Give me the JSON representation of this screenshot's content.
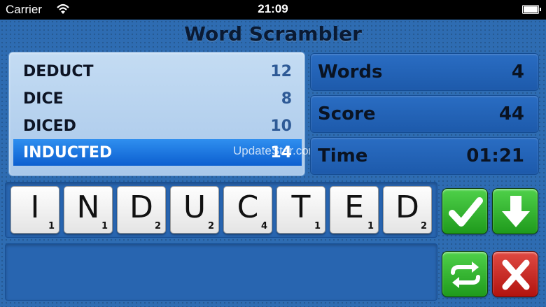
{
  "status_bar": {
    "carrier": "Carrier",
    "time": "21:09"
  },
  "app": {
    "title": "Word Scrambler"
  },
  "words": [
    {
      "word": "DEDUCT",
      "points": "12",
      "selected": false
    },
    {
      "word": "DICE",
      "points": "8",
      "selected": false
    },
    {
      "word": "DICED",
      "points": "10",
      "selected": false
    },
    {
      "word": "INDUCTED",
      "points": "14",
      "selected": true
    }
  ],
  "watermark": "UpdateStar.com",
  "stats": {
    "words_label": "Words",
    "words_value": "4",
    "score_label": "Score",
    "score_value": "44",
    "time_label": "Time",
    "time_value": "01:21"
  },
  "tiles": [
    {
      "letter": "I",
      "points": "1"
    },
    {
      "letter": "N",
      "points": "1"
    },
    {
      "letter": "D",
      "points": "2"
    },
    {
      "letter": "U",
      "points": "2"
    },
    {
      "letter": "C",
      "points": "4"
    },
    {
      "letter": "T",
      "points": "1"
    },
    {
      "letter": "E",
      "points": "1"
    },
    {
      "letter": "D",
      "points": "2"
    }
  ],
  "buttons": {
    "submit_icon": "checkmark-icon",
    "drop_icon": "down-arrow-icon",
    "shuffle_icon": "shuffle-icon",
    "clear_icon": "x-icon"
  },
  "colors": {
    "background": "#2e6cb2",
    "selected_row": "#0c5fd0",
    "green_button": "#1f9a1c",
    "red_button": "#b2130e"
  }
}
